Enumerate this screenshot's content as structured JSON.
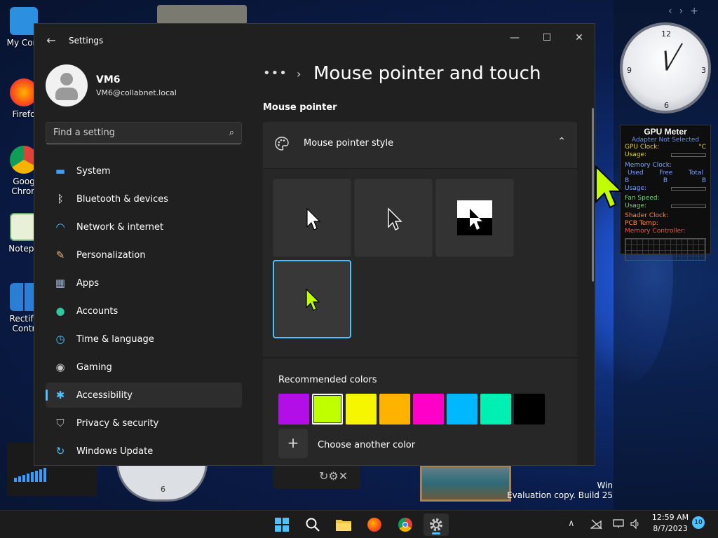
{
  "desktop": {
    "icons": [
      {
        "label": "My Com",
        "color": "#2d8fe0"
      },
      {
        "label": "Firefo",
        "color": "#ff7a1a"
      },
      {
        "label": "Goog Chron",
        "color": "#db4437"
      },
      {
        "label": "Notepa",
        "color": "#6fa86b"
      },
      {
        "label": "Rectify Contr",
        "color": "#2a7fd4"
      }
    ],
    "eval_line1": "Win",
    "eval_line2": "Evaluation copy. Build 25"
  },
  "gadgets": {
    "clock": {
      "n12": "12",
      "n3": "3",
      "n6": "6",
      "n9": "9"
    },
    "gauge_bottom_num": "6",
    "gpu_meter": {
      "title": "GPU Meter",
      "adapter": "Adapter Not Selected",
      "gpu_clock": "GPU Clock:",
      "gpu_unit": "°C",
      "usage1": "Usage:",
      "memory_clock": "Memory Clock:",
      "used": "Used",
      "free": "Free",
      "total": "Total",
      "b1": "B",
      "b2": "B",
      "b3": "B",
      "usage2": "Usage:",
      "fan_speed": "Fan Speed:",
      "usage3": "Usage:",
      "shader_clock": "Shader Clock:",
      "pcb_temp": "PCB Temp:",
      "memory_controller": "Memory Controller:"
    }
  },
  "window": {
    "title": "Settings",
    "back_glyph": "←",
    "minimize_glyph": "—",
    "maximize_glyph": "☐",
    "close_glyph": "✕"
  },
  "user": {
    "name": "VM6",
    "email": "VM6@collabnet.local"
  },
  "search": {
    "placeholder": "Find a setting",
    "icon_glyph": "⌕"
  },
  "nav_items": [
    {
      "label": "System",
      "icon": "monitor-icon",
      "glyph": "▬",
      "color": "#3aa0ff"
    },
    {
      "label": "Bluetooth & devices",
      "icon": "bluetooth-icon",
      "glyph": "ᛒ",
      "color": "#ffffff"
    },
    {
      "label": "Network & internet",
      "icon": "wifi-icon",
      "glyph": "◠",
      "color": "#4cc2ff"
    },
    {
      "label": "Personalization",
      "icon": "brush-icon",
      "glyph": "✎",
      "color": "#e8b07a"
    },
    {
      "label": "Apps",
      "icon": "apps-icon",
      "glyph": "▦",
      "color": "#9ab0d0"
    },
    {
      "label": "Accounts",
      "icon": "person-icon",
      "glyph": "●",
      "color": "#2fc9a0"
    },
    {
      "label": "Time & language",
      "icon": "globe-clock-icon",
      "glyph": "◷",
      "color": "#4cc2ff"
    },
    {
      "label": "Gaming",
      "icon": "gamepad-icon",
      "glyph": "◉",
      "color": "#c8c8c8"
    },
    {
      "label": "Accessibility",
      "icon": "accessibility-icon",
      "glyph": "✱",
      "color": "#4cc2ff"
    },
    {
      "label": "Privacy & security",
      "icon": "shield-icon",
      "glyph": "⛉",
      "color": "#b0b0b0"
    },
    {
      "label": "Windows Update",
      "icon": "update-icon",
      "glyph": "↻",
      "color": "#4cc2ff"
    }
  ],
  "active_nav": "Accessibility",
  "breadcrumb": {
    "dots": "•••",
    "separator": "›",
    "title": "Mouse pointer and touch"
  },
  "mouse_pointer": {
    "section_label": "Mouse pointer",
    "expander_label": "Mouse pointer style",
    "expander_chevron": "⌃",
    "styles": [
      "white",
      "black",
      "inverted",
      "custom"
    ],
    "selected_style": "custom"
  },
  "colors": {
    "title": "Recommended colors",
    "swatches": [
      "#b40ee8",
      "#bfff00",
      "#f6f600",
      "#ffb300",
      "#ff00c8",
      "#00b8ff",
      "#00f0b4",
      "#000000"
    ],
    "selected": "#bfff00",
    "add_glyph": "+",
    "add_label": "Choose another color"
  },
  "taskbar": {
    "time": "12:59 AM",
    "date": "8/7/2023",
    "notifications": "10",
    "tray_chevron": "∧"
  }
}
